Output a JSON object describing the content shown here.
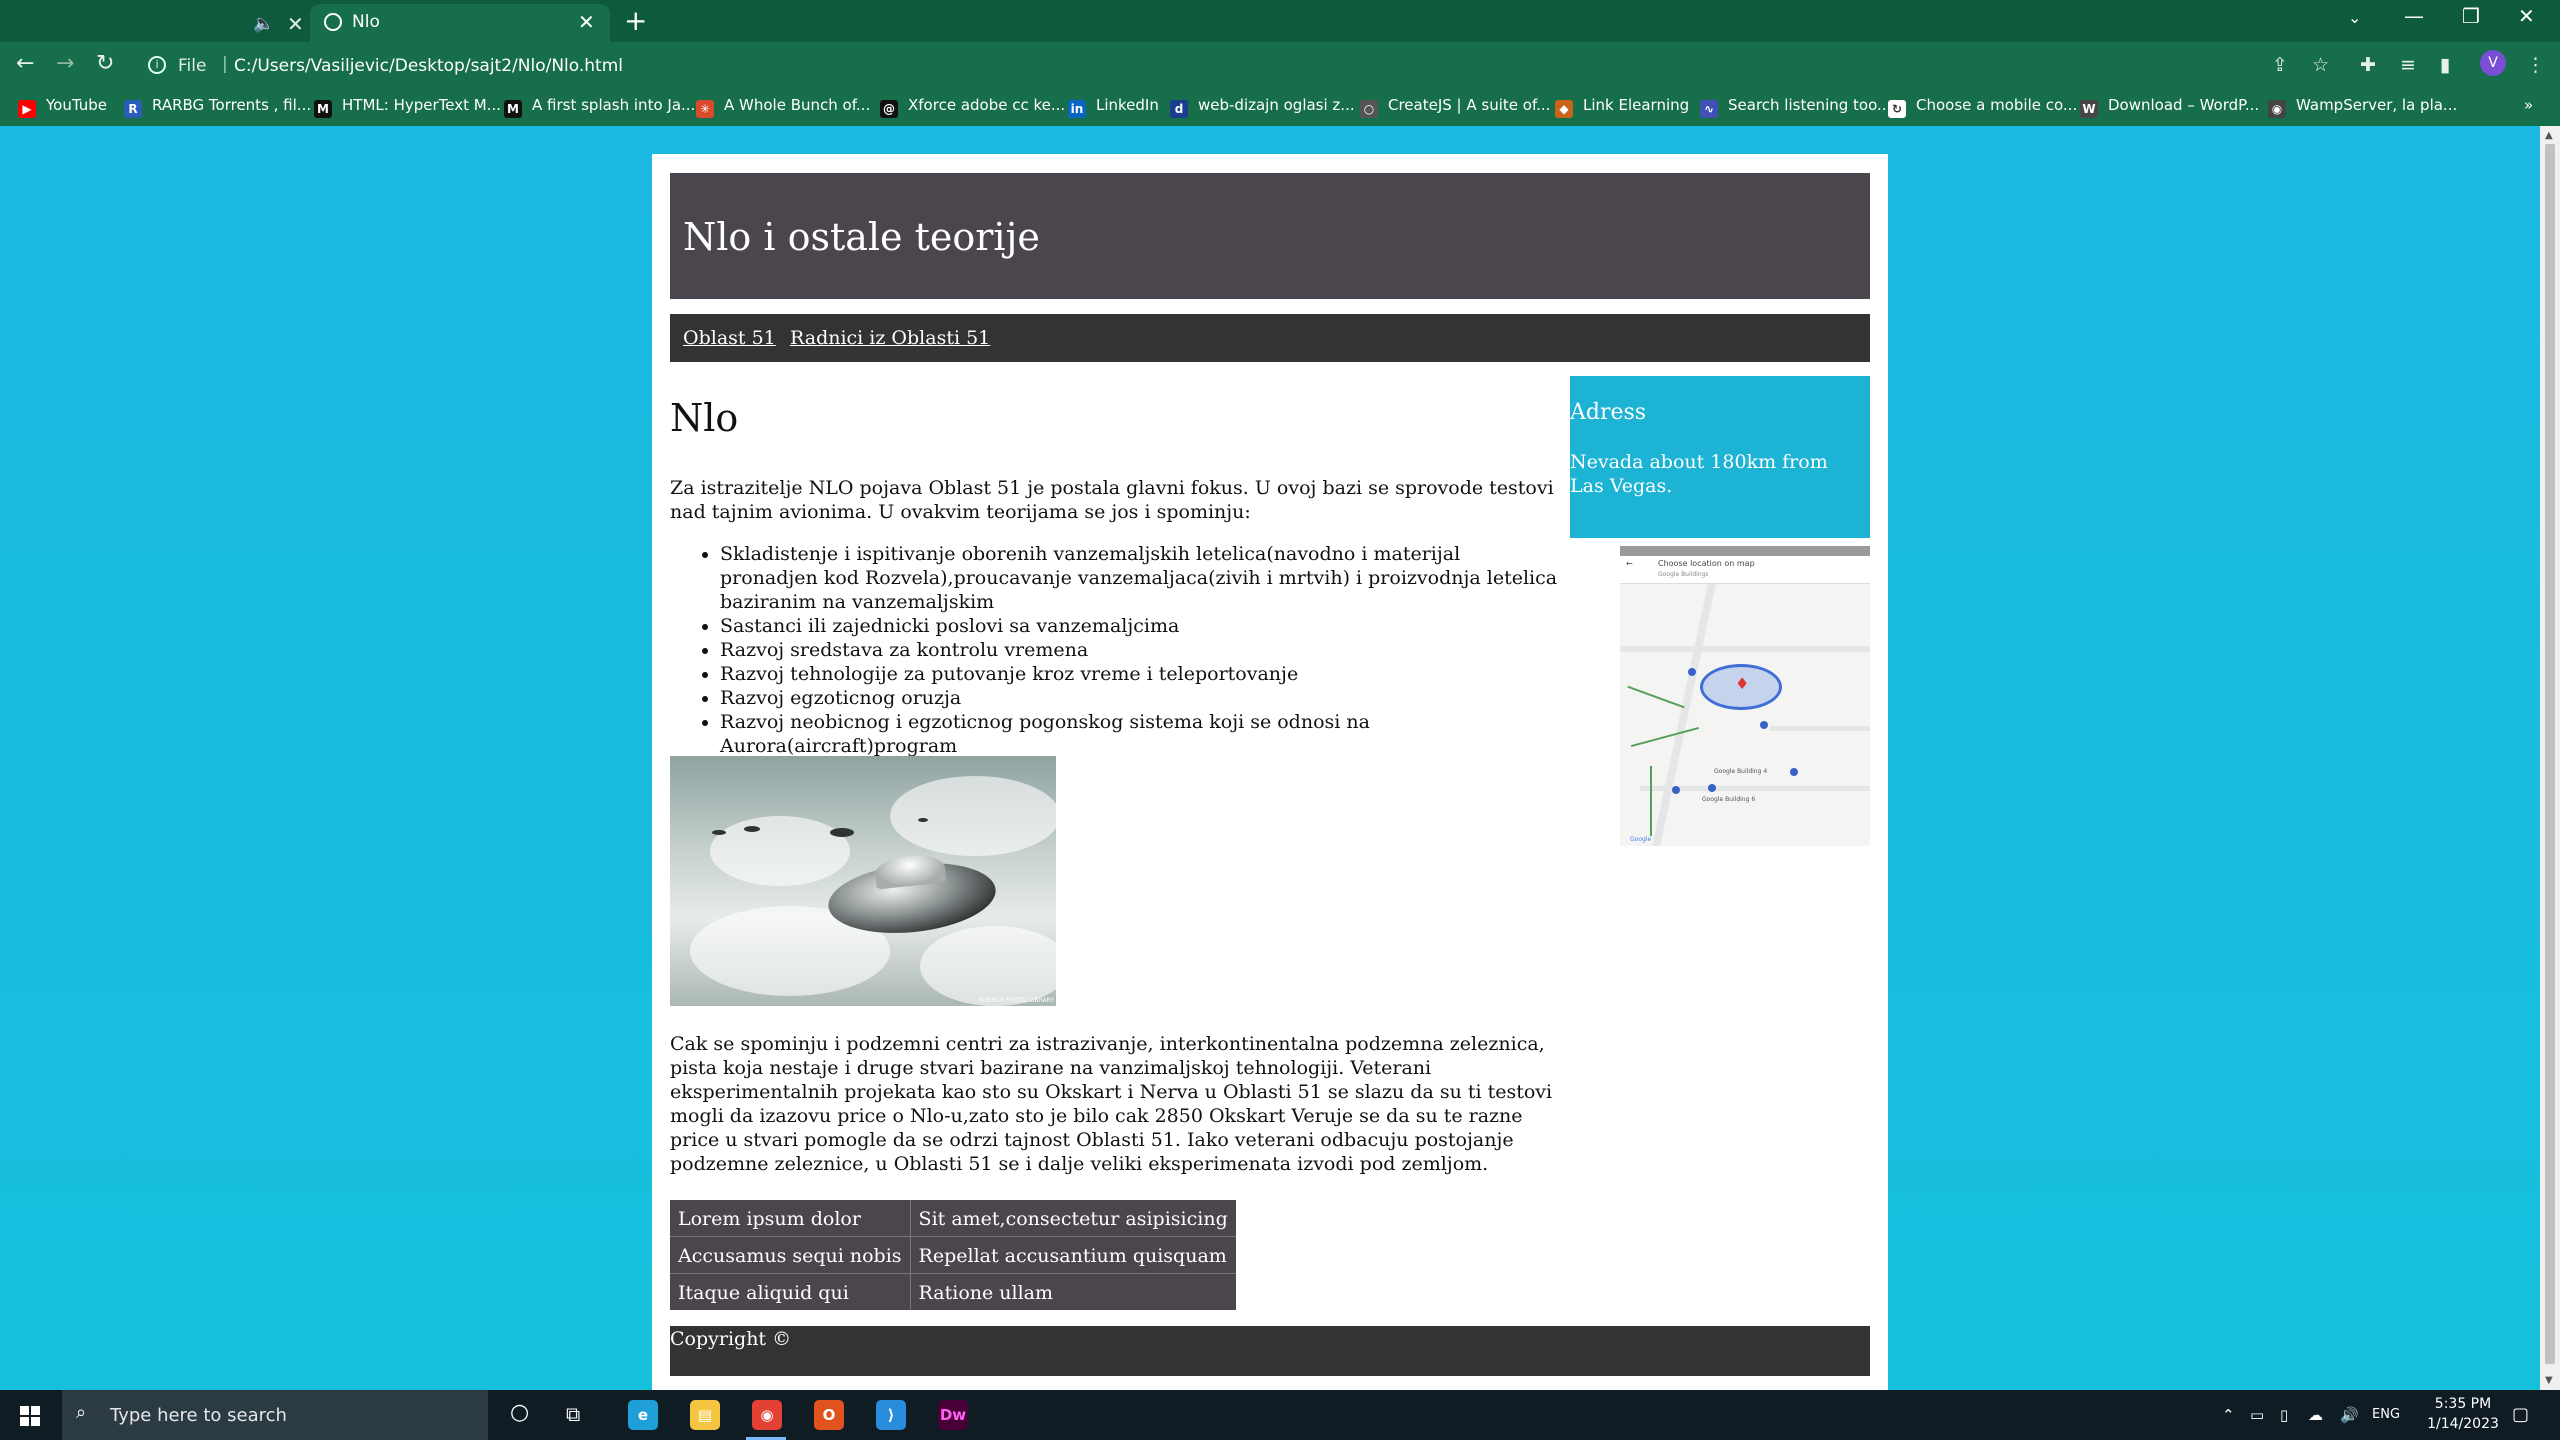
{
  "browser": {
    "tabs": [
      {
        "title": ""
      },
      {
        "title": "Nlo"
      }
    ],
    "new_tab_icon": "+",
    "url_scheme": "File",
    "url": "C:/Users/Vasiljevic/Desktop/sajt2/Nlo/Nlo.html",
    "profile_initial": "V",
    "bookmarks": [
      {
        "label": "YouTube",
        "icon": "youtube-icon",
        "color": "#ff0000",
        "glyph": "▶"
      },
      {
        "label": "RARBG Torrents , fil...",
        "icon": "rarbg-icon",
        "color": "#2b5db8",
        "glyph": "R"
      },
      {
        "label": "HTML: HyperText M...",
        "icon": "mdn-icon",
        "color": "#111111",
        "glyph": "M"
      },
      {
        "label": "A first splash into Ja...",
        "icon": "mdn-icon",
        "color": "#111111",
        "glyph": "M"
      },
      {
        "label": "A Whole Bunch of...",
        "icon": "star-icon",
        "color": "#d94a2b",
        "glyph": "✳"
      },
      {
        "label": "Xforce adobe cc ke...",
        "icon": "swirl-icon",
        "color": "#111111",
        "glyph": "@"
      },
      {
        "label": "LinkedIn",
        "icon": "linkedin-icon",
        "color": "#0a66c2",
        "glyph": "in"
      },
      {
        "label": "web-dizajn oglasi z...",
        "icon": "dizajn-icon",
        "color": "#1a3d8f",
        "glyph": "d"
      },
      {
        "label": "CreateJS | A suite of...",
        "icon": "createjs-icon",
        "color": "#555555",
        "glyph": "○"
      },
      {
        "label": "Link Elearning",
        "icon": "elearning-icon",
        "color": "#c8651b",
        "glyph": "◆"
      },
      {
        "label": "Search listening too...",
        "icon": "listening-icon",
        "color": "#3f51b5",
        "glyph": "∿"
      },
      {
        "label": "Choose a mobile co...",
        "icon": "mobile-icon",
        "color": "#ffffff",
        "glyph": "↻"
      },
      {
        "label": "Download – WordP...",
        "icon": "wordpress-icon",
        "color": "#464646",
        "glyph": "W"
      },
      {
        "label": "WampServer, la pla...",
        "icon": "wamp-icon",
        "color": "#444444",
        "glyph": "◉"
      }
    ]
  },
  "site": {
    "header_title": "Nlo i ostale teorije",
    "nav": [
      "Oblast 51",
      "Radnici iz Oblasti 51"
    ],
    "heading": "Nlo",
    "intro": "Za istrazitelje NLO pojava Oblast 51 je postala glavni fokus. U ovoj bazi se sprovode testovi nad tajnim avionima. U ovakvim teorijama se jos i spominju:",
    "list": [
      "Skladistenje i ispitivanje oborenih vanzemaljskih letelica(navodno i materijal pronadjen kod Rozvela),proucavanje vanzemaljaca(zivih i mrtvih) i proizvodnja letelica baziranim na vanzemaljskim",
      "Sastanci ili zajednicki poslovi sa vanzemaljcima",
      "Razvoj sredstava za kontrolu vremena",
      "Razvoj tehnologije za putovanje kroz vreme i teleportovanje",
      "Razvoj egzoticnog oruzja",
      "Razvoj neobicnog i egzoticnog pogonskog sistema koji se odnosi na Aurora(aircraft)program"
    ],
    "image_credit": "SCIENCE PHOTO LIBRARY",
    "paragraph2": "Cak se spominju i podzemni centri za istrazivanje, interkontinentalna podzemna zeleznica, pista koja nestaje i druge stvari bazirane na vanzimaljskoj tehnologiji. Veterani eksperimentalnih projekata kao sto su Okskart i Nerva u Oblasti 51 se slazu da su ti testovi mogli da izazovu price o Nlo-u,zato sto je bilo cak 2850 Okskart Veruje se da su te razne price u stvari pomogle da se odrzi tajnost Oblasti 51. Iako veterani odbacuju postojanje podzemne zeleznice, u Oblasti 51 se i dalje veliki eksperimenata izvodi pod zemljom.",
    "table": [
      [
        "Lorem ipsum dolor",
        "Sit amet,consectetur asipisicing"
      ],
      [
        "Accusamus sequi nobis",
        "Repellat accusantium quisquam"
      ],
      [
        "Itaque aliquid qui",
        "Ratione ullam"
      ]
    ],
    "aside": {
      "title": "Adress",
      "text": "Nevada about 180km from Las Vegas."
    },
    "map": {
      "header": "Choose location on map",
      "sub": "Google Buildings",
      "labels": [
        "Google Building 4",
        "Google Building 6",
        "Google"
      ]
    },
    "footer": "Copyright ©"
  },
  "taskbar": {
    "search_placeholder": "Type here to search",
    "language": "ENG",
    "time": "5:35 PM",
    "date": "1/14/2023",
    "apps": [
      {
        "icon": "edge-icon",
        "glyph": "e",
        "color": "#1f9fd8"
      },
      {
        "icon": "file-explorer-icon",
        "glyph": "▤",
        "color": "#f5c542"
      },
      {
        "icon": "chrome-icon",
        "glyph": "◉",
        "color": "#e34133"
      },
      {
        "icon": "office-icon",
        "glyph": "O",
        "color": "#e2521d"
      },
      {
        "icon": "vscode-icon",
        "glyph": "⟩",
        "color": "#2a8ddb"
      },
      {
        "icon": "dreamweaver-icon",
        "glyph": "Dw",
        "color": "#470137"
      }
    ]
  },
  "colors": {
    "page_bg": "#1ab4e0",
    "header_bg": "#4b464d",
    "nav_bg": "#333333",
    "aside_bg": "#1cb3d4",
    "chrome_bg": "#176e4a"
  }
}
